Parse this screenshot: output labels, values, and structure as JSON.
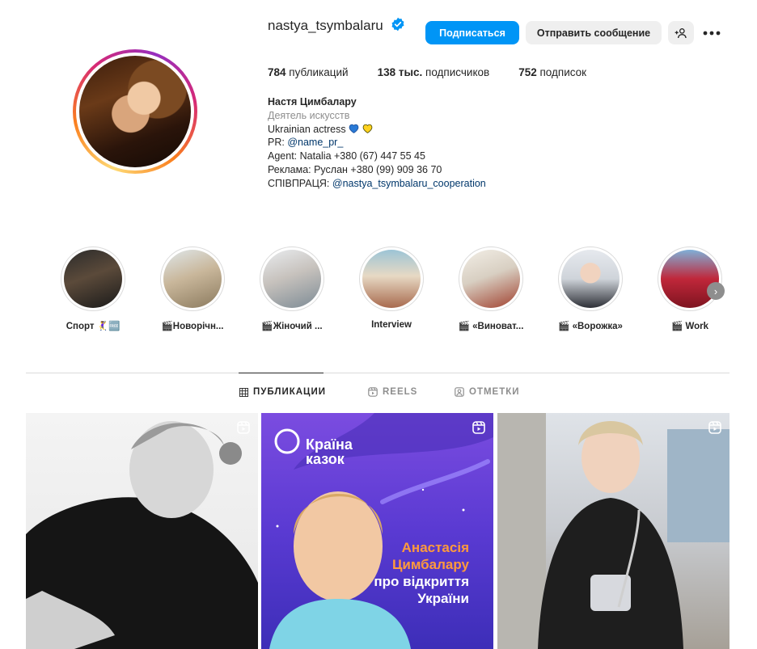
{
  "profile": {
    "username": "nastya_tsymbalaru",
    "verified_icon": "verified-badge-icon",
    "follow_label": "Подписаться",
    "message_label": "Отправить сообщение",
    "add_user_icon": "add-person-icon",
    "more_icon": "more-dots-icon"
  },
  "stats": {
    "posts_count": "784",
    "posts_label": "публикаций",
    "followers_count": "138 тыс.",
    "followers_label": "подписчиков",
    "following_count": "752",
    "following_label": "подписок"
  },
  "bio": {
    "name": "Настя Цимбалару",
    "category": "Деятель искусств",
    "line1": "Ukrainian actress",
    "line2_prefix": "PR: ",
    "line2_link": "@name_pr_",
    "line3": "Agent: Natalia +380 (67) 447 55 45",
    "line4": "Реклама: Руслан +380 (99) 909 36 70",
    "line5_prefix": "СПІВПРАЦЯ: ",
    "line5_link": "@nastya_tsymbalaru_cooperation"
  },
  "highlights": [
    {
      "label": "Спорт 🤾‍♀️🆓"
    },
    {
      "label": "🎬Новорічн..."
    },
    {
      "label": "🎬Жіночий ..."
    },
    {
      "label": "Interview"
    },
    {
      "label": "🎬 «Виноват..."
    },
    {
      "label": "🎬 «Ворожка»"
    },
    {
      "label": "🎬 Work"
    }
  ],
  "tabs": {
    "posts": "ПУБЛИКАЦИИ",
    "reels": "REELS",
    "tagged": "ОТМЕТКИ"
  },
  "posts": {
    "post2": {
      "brand_line1": "Країна",
      "brand_line2": "казок",
      "text_line1": "Анастасія",
      "text_line2": "Цимбалару",
      "text_line3": "про відкриття",
      "text_line4": "України"
    }
  },
  "colors": {
    "accent": "#0095f6",
    "link": "#00376b",
    "muted": "#8e8e8e"
  }
}
